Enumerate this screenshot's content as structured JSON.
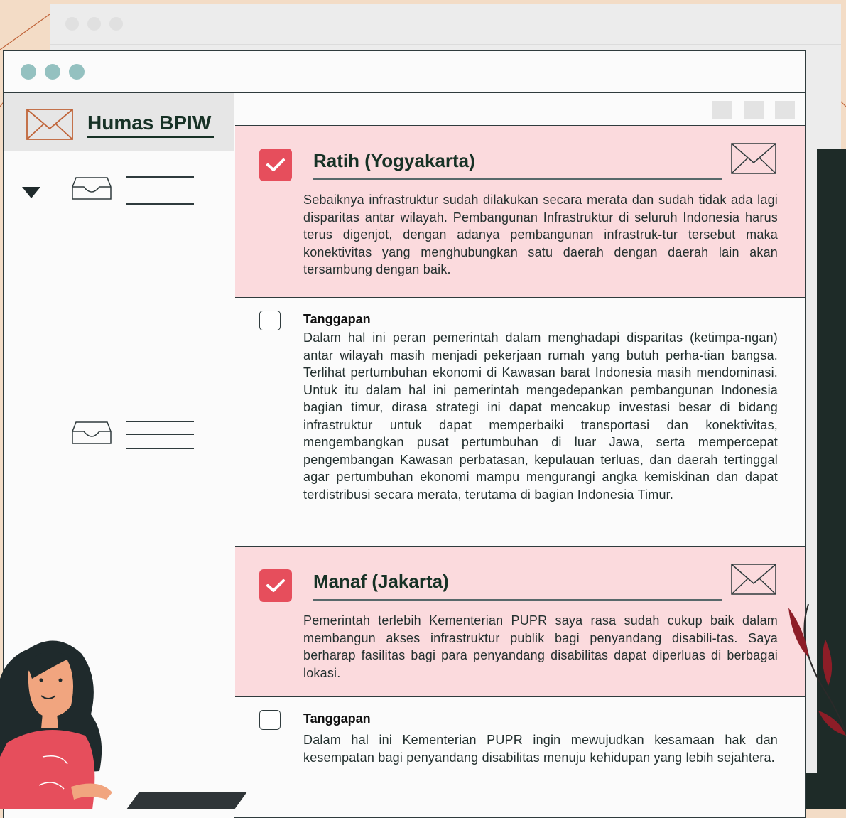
{
  "app": {
    "title": "Humas BPIW"
  },
  "colors": {
    "accent": "#e64e5c",
    "pink_bg": "#fbdadd",
    "brand": "#173226",
    "dots": "#94c1c0"
  },
  "sidebar": {
    "folders": [
      {
        "icon": "inbox-icon",
        "expanded": true
      },
      {
        "icon": "inbox-icon",
        "expanded": false
      }
    ]
  },
  "messages": [
    {
      "checked": true,
      "sender": "Ratih (Yogyakarta)",
      "body": "Sebaiknya infrastruktur sudah dilakukan secara merata dan  sudah tidak ada lagi disparitas antar wilayah. Pembangunan Infrastruktur di seluruh Indonesia harus terus digenjot, dengan adanya pembangunan infrastruk-tur tersebut maka konektivitas yang menghubungkan satu daerah dengan daerah lain akan tersambung dengan baik.",
      "reply": {
        "checked": false,
        "title": "Tanggapan",
        "body": "Dalam hal ini peran pemerintah dalam menghadapi disparitas (ketimpa-ngan) antar wilayah masih menjadi pekerjaan rumah yang butuh perha-tian bangsa. Terlihat pertumbuhan ekonomi di Kawasan barat Indonesia masih mendominasi. Untuk itu dalam hal ini pemerintah mengedepankan pembangunan Indonesia bagian timur, dirasa strategi ini dapat mencakup investasi besar di bidang infrastruktur untuk dapat memperbaiki transportasi dan konektivitas, mengembangkan pusat pertumbuhan di luar Jawa, serta mempercepat pengembangan Kawasan perbatasan, kepulauan terluas, dan daerah tertinggal agar pertumbuhan ekonomi mampu mengurangi angka kemiskinan dan dapat terdistribusi secara merata, terutama di bagian Indonesia Timur."
      }
    },
    {
      "checked": true,
      "sender": "Manaf (Jakarta)",
      "body": "Pemerintah terlebih Kementerian PUPR saya rasa sudah cukup baik dalam membangun akses infrastruktur publik bagi penyandang disabili-tas. Saya berharap fasilitas bagi para penyandang disabilitas dapat diperluas di berbagai lokasi.",
      "reply": {
        "checked": false,
        "title": "Tanggapan",
        "body": "Dalam hal ini Kementerian PUPR ingin mewujudkan kesamaan hak dan kesempatan bagi penyandang disabilitas menuju kehidupan yang lebih sejahtera."
      }
    }
  ]
}
